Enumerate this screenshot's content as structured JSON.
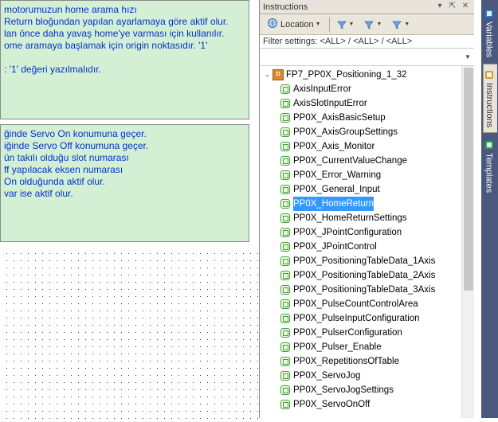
{
  "left": {
    "box1_lines": [
      "motorumuzun home arama hızı",
      "Return bloğundan yapılan ayarlamaya göre aktif olur.",
      "lan önce daha yavaş home'ye varması için kullanılır.",
      "ome aramaya başlamak için origin noktasıdır. '1'",
      "",
      ": '1' değeri yazılmalıdır."
    ],
    "box2_lines": [
      "ğinde Servo On konumuna geçer.",
      "iğinde Servo Off konumuna geçer.",
      "ün takılı olduğu slot numarası",
      "ff yapılacak eksen numarası",
      "On olduğunda aktif olur.",
      "var ise aktif olur."
    ]
  },
  "panel": {
    "title": "Instructions",
    "toolbar": {
      "location_label": "Location"
    },
    "filter_label": "Filter settings: <ALL> / <ALL> / <ALL>",
    "search_placeholder": "",
    "tree": {
      "root": "FP7_PP0X_Positioning_1_32",
      "items": [
        "AxisInputError",
        "AxisSlotInputError",
        "PP0X_AxisBasicSetup",
        "PP0X_AxisGroupSettings",
        "PP0X_Axis_Monitor",
        "PP0X_CurrentValueChange",
        "PP0X_Error_Warning",
        "PP0X_General_Input",
        "PP0X_HomeReturn",
        "PP0X_HomeReturnSettings",
        "PP0X_JPointConfiguration",
        "PP0X_JPointControl",
        "PP0X_PositioningTableData_1Axis",
        "PP0X_PositioningTableData_2Axis",
        "PP0X_PositioningTableData_3Axis",
        "PP0X_PulseCountControlArea",
        "PP0X_PulseInputConfiguration",
        "PP0X_PulserConfiguration",
        "PP0X_Pulser_Enable",
        "PP0X_RepetitionsOfTable",
        "PP0X_ServoJog",
        "PP0X_ServoJogSettings",
        "PP0X_ServoOnOff"
      ],
      "selected_index": 8
    }
  },
  "side_tabs": [
    {
      "label": "Variables",
      "icon_color": "#2a78d0"
    },
    {
      "label": "Instructions",
      "icon_color": "#d0a030"
    },
    {
      "label": "Templates",
      "icon_color": "#30a050"
    }
  ],
  "active_side_tab": 1
}
